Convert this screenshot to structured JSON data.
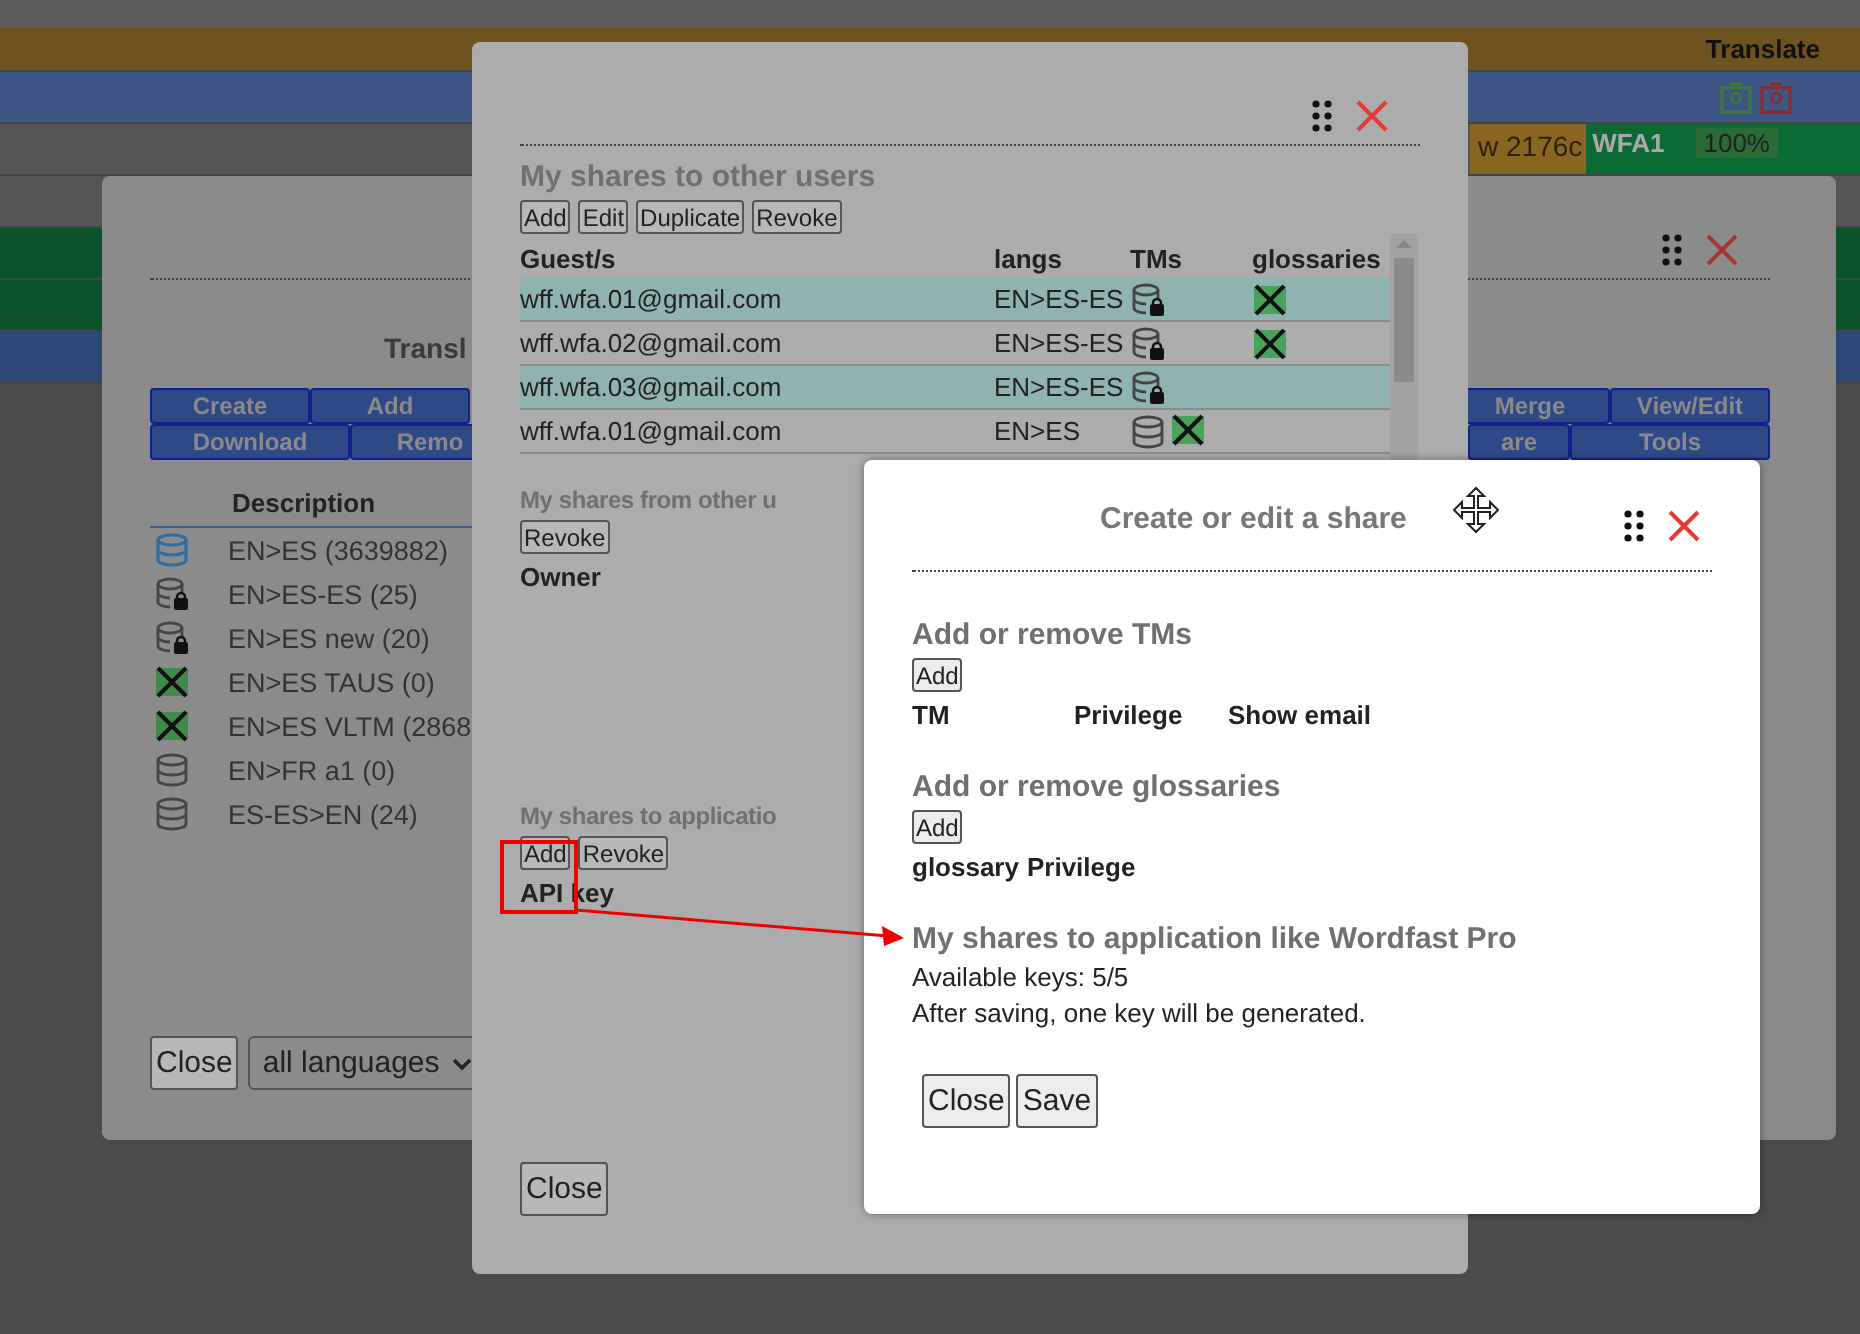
{
  "page": {
    "header": "Translate",
    "row": [
      "w 2176c",
      "WFA1",
      "100%"
    ]
  },
  "tm_window": {
    "title": "Transl",
    "buttons_left": [
      [
        "Create",
        "Add"
      ],
      [
        "Download",
        "Remo"
      ]
    ],
    "buttons_right": [
      [
        "Merge",
        "View/Edit"
      ],
      [
        "are",
        "Tools"
      ]
    ],
    "column": "Description",
    "rows": [
      {
        "kind": "active",
        "label": "EN>ES (3639882)"
      },
      {
        "kind": "locked",
        "label": "EN>ES-ES (25)"
      },
      {
        "kind": "locked",
        "label": "EN>ES new (20)"
      },
      {
        "kind": "glossary",
        "label": "EN>ES TAUS (0)"
      },
      {
        "kind": "glossary",
        "label": "EN>ES VLTM (2868"
      },
      {
        "kind": "plain",
        "label": "EN>FR a1 (0)"
      },
      {
        "kind": "plain",
        "label": "ES-ES>EN (24)"
      }
    ],
    "close": "Close",
    "language_select": "all languages"
  },
  "shares_window": {
    "to_users": {
      "heading": "My shares to other users",
      "buttons": [
        "Add",
        "Edit",
        "Duplicate",
        "Revoke"
      ],
      "columns": [
        "Guest/s",
        "langs",
        "TMs",
        "glossaries"
      ],
      "rows": [
        {
          "guest": "wff.wfa.01@gmail.com",
          "langs": "EN>ES-ES",
          "selected": true,
          "tms": [
            {
              "kind": "locked"
            }
          ],
          "glossaries": [
            {
              "kind": "glossary"
            }
          ]
        },
        {
          "guest": "wff.wfa.02@gmail.com",
          "langs": "EN>ES-ES",
          "selected": false,
          "tms": [
            {
              "kind": "locked"
            }
          ],
          "glossaries": [
            {
              "kind": "glossary"
            }
          ]
        },
        {
          "guest": "wff.wfa.03@gmail.com",
          "langs": "EN>ES-ES",
          "selected": true,
          "tms": [
            {
              "kind": "locked"
            }
          ]
        },
        {
          "guest": "wff.wfa.01@gmail.com",
          "langs": "EN>ES",
          "selected": false,
          "tms": [
            {
              "kind": "plain"
            },
            {
              "kind": "glossary"
            }
          ]
        }
      ]
    },
    "from_users": {
      "heading": "My shares from other u",
      "buttons": [
        "Revoke"
      ],
      "columns": [
        "Owner"
      ]
    },
    "to_apps": {
      "heading": "My shares to applicatio",
      "buttons": [
        "Add",
        "Revoke"
      ],
      "columns": [
        "API key"
      ]
    },
    "close": "Close"
  },
  "share_dialog": {
    "title": "Create or edit a share",
    "tms": {
      "heading": "Add or remove TMs",
      "button": "Add",
      "columns": [
        "TM",
        "Privilege",
        "Show email"
      ]
    },
    "glossaries": {
      "heading": "Add or remove glossaries",
      "button": "Add",
      "columns": [
        "glossary",
        "Privilege"
      ]
    },
    "apps": {
      "heading": "My shares to application like Wordfast Pro",
      "lines": [
        "Available keys: 5/5",
        "After saving, one key will be generated."
      ]
    },
    "buttons": [
      "Close",
      "Save"
    ]
  }
}
